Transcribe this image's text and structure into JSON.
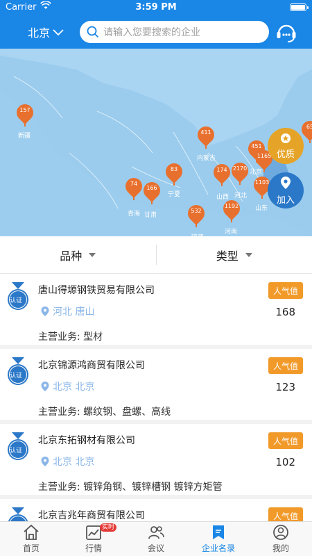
{
  "status": {
    "carrier": "Carrier",
    "time": "3:59 PM"
  },
  "header": {
    "city": "北京",
    "search_placeholder": "请输入您要搜索的企业"
  },
  "map": {
    "pins": [
      "157",
      "411",
      "83",
      "74",
      "166",
      "532",
      "174",
      "2170",
      "451",
      "1165",
      "1103",
      "1192",
      "65"
    ],
    "regions": [
      "新疆",
      "内蒙古",
      "青海",
      "甘肃",
      "宁夏",
      "陕西",
      "山西",
      "河北",
      "北京",
      "山东",
      "河南"
    ],
    "buttons": {
      "quality": "优质",
      "join": "加入"
    }
  },
  "filters": {
    "variety": "品种",
    "type": "类型"
  },
  "companies": [
    {
      "name": "唐山得塬钢铁贸易有限公司",
      "location": "河北 唐山",
      "popularity_label": "人气值",
      "popularity": "168",
      "business": "主营业务: 型材",
      "badge": "认证"
    },
    {
      "name": "北京锦源鸿商贸有限公司",
      "location": "北京 北京",
      "popularity_label": "人气值",
      "popularity": "123",
      "business": "主营业务: 螺纹钢、盘螺、高线",
      "badge": "认证"
    },
    {
      "name": "北京东拓钢材有限公司",
      "location": "北京 北京",
      "popularity_label": "人气值",
      "popularity": "102",
      "business": "主营业务: 镀锌角钢、镀锌槽钢 镀锌方矩管",
      "badge": "认证"
    },
    {
      "name": "北京吉兆年商贸有限公司",
      "location": "",
      "popularity_label": "人气值",
      "popularity": "",
      "business": "",
      "badge": "认证"
    }
  ],
  "tabs": [
    {
      "label": "首页"
    },
    {
      "label": "行情",
      "badge": "实时"
    },
    {
      "label": "会议"
    },
    {
      "label": "企业名录"
    },
    {
      "label": "我的"
    }
  ],
  "colors": {
    "primary": "#1a86e6",
    "pin": "#e8702e",
    "popularity": "#f19a2a"
  }
}
